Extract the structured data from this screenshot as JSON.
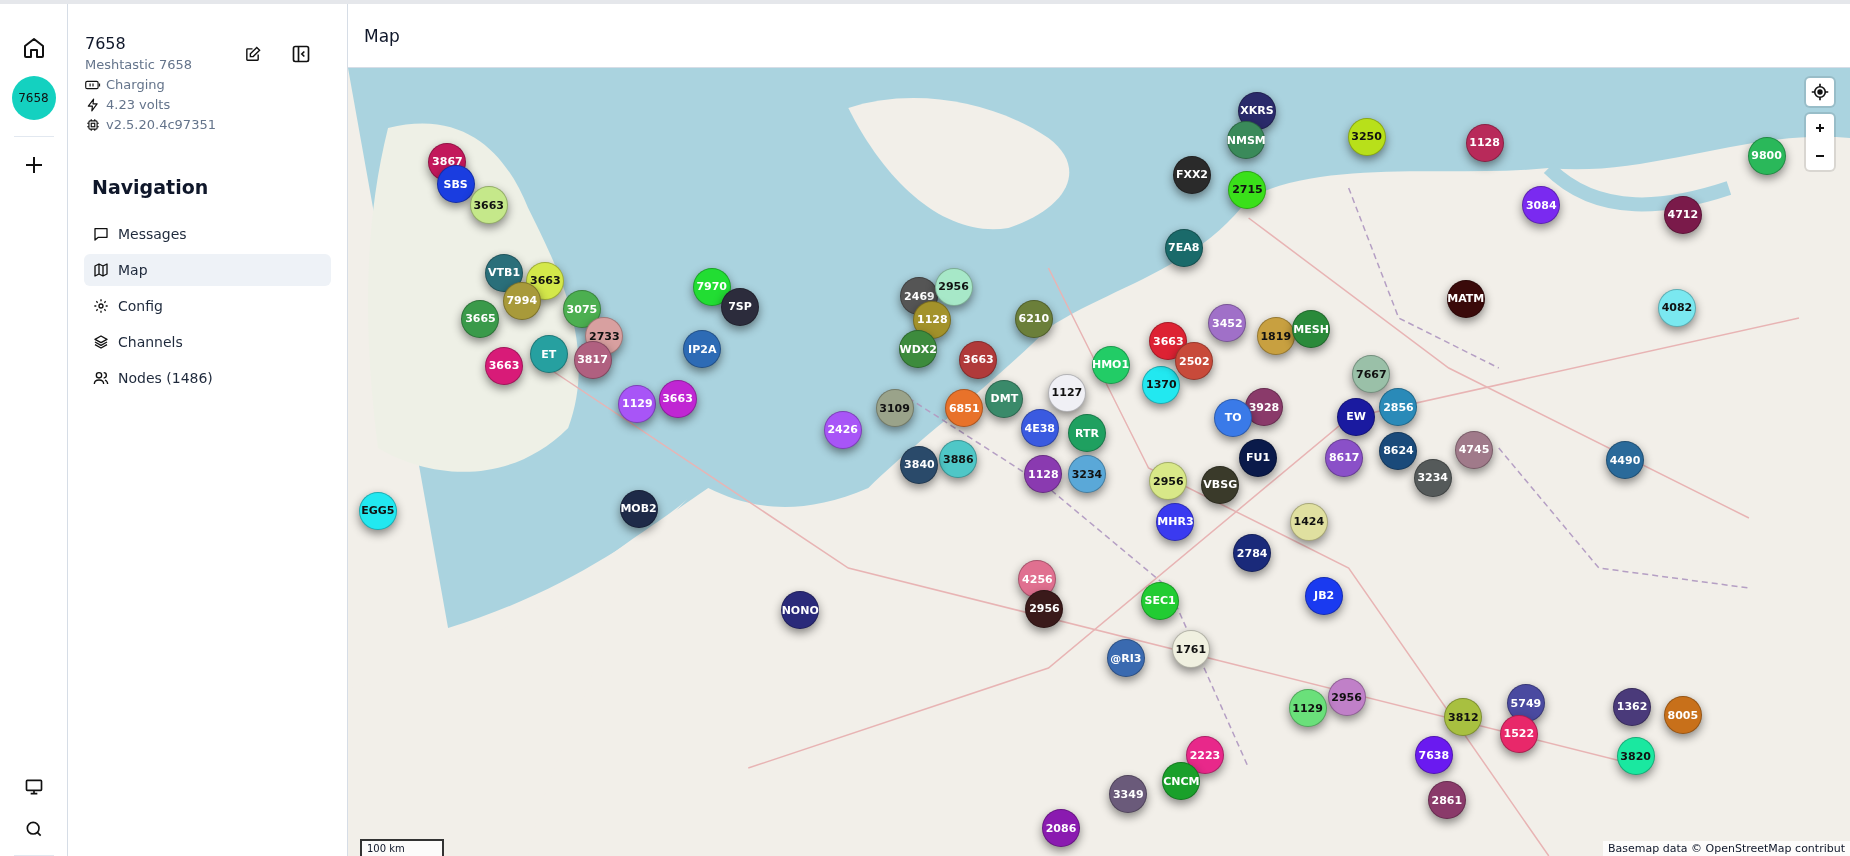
{
  "rail": {
    "avatar": "7658"
  },
  "device": {
    "name": "7658",
    "long_name": "Meshtastic 7658",
    "battery": "Charging",
    "voltage": "4.23 volts",
    "firmware": "v2.5.20.4c97351"
  },
  "navigation": {
    "title": "Navigation",
    "items": [
      {
        "label": "Messages",
        "kind": "messages",
        "selected": false
      },
      {
        "label": "Map",
        "kind": "map",
        "selected": true
      },
      {
        "label": "Config",
        "kind": "config",
        "selected": false
      },
      {
        "label": "Channels",
        "kind": "channels",
        "selected": false
      },
      {
        "label": "Nodes (1486)",
        "kind": "nodes",
        "selected": false
      }
    ]
  },
  "header": {
    "title": "Map"
  },
  "map": {
    "scale": "100 km",
    "attribution": "Basemap data © OpenStreetMap contribut",
    "markers": [
      {
        "label": "3867",
        "color": "#c2185b"
      },
      {
        "label": "SBS",
        "color": "#1a3de0"
      },
      {
        "label": "3663",
        "color": "#c5e88a"
      },
      {
        "label": "VTB1",
        "color": "#2a6f7a"
      },
      {
        "label": "3663",
        "color": "#d4e84a"
      },
      {
        "label": "7994",
        "color": "#a89a3a"
      },
      {
        "label": "3075",
        "color": "#4caf50"
      },
      {
        "label": "2733",
        "color": "#d8a0a0"
      },
      {
        "label": "3665",
        "color": "#3a9a4a"
      },
      {
        "label": "3663",
        "color": "#d81b78"
      },
      {
        "label": "ET",
        "color": "#26a0a0"
      },
      {
        "label": "3817",
        "color": "#b06080"
      },
      {
        "label": "1129",
        "color": "#a855f7"
      },
      {
        "label": "3663",
        "color": "#c026d3"
      },
      {
        "label": "IP2A",
        "color": "#2d6bb5"
      },
      {
        "label": "7970",
        "color": "#22dd33"
      },
      {
        "label": "7SP",
        "color": "#2c2c3c"
      },
      {
        "label": "2469",
        "color": "#555555"
      },
      {
        "label": "2956",
        "color": "#a7e8c8"
      },
      {
        "label": "1128",
        "color": "#a3922a"
      },
      {
        "label": "WDX2",
        "color": "#3d8b3d"
      },
      {
        "label": "6210",
        "color": "#6b7f3a"
      },
      {
        "label": "3663",
        "color": "#b03a3a"
      },
      {
        "label": "DMT",
        "color": "#3a8a6a"
      },
      {
        "label": "3109",
        "color": "#9aa38a"
      },
      {
        "label": "6851",
        "color": "#e8722a"
      },
      {
        "label": "2426",
        "color": "#a855f7"
      },
      {
        "label": "3886",
        "color": "#4fc7c7"
      },
      {
        "label": "3840",
        "color": "#2a4a6a"
      },
      {
        "label": "MOB2",
        "color": "#1e2a48"
      },
      {
        "label": "EGG5",
        "color": "#22e8f0"
      },
      {
        "label": "1127",
        "color": "#f0f0f5"
      },
      {
        "label": "4E38",
        "color": "#3a5ae0"
      },
      {
        "label": "RTR",
        "color": "#1fa060"
      },
      {
        "label": "1128",
        "color": "#8a3ab0"
      },
      {
        "label": "3234",
        "color": "#5aa8d8"
      },
      {
        "label": "HMO1",
        "color": "#22cc66"
      },
      {
        "label": "1370",
        "color": "#22e8f0"
      },
      {
        "label": "3663",
        "color": "#dd2233"
      },
      {
        "label": "2502",
        "color": "#c84a3a"
      },
      {
        "label": "3452",
        "color": "#a070c8"
      },
      {
        "label": "1819",
        "color": "#c8a040"
      },
      {
        "label": "MESH",
        "color": "#2a8a3a"
      },
      {
        "label": "7667",
        "color": "#9ac0a8"
      },
      {
        "label": "3928",
        "color": "#8a3a6a"
      },
      {
        "label": "TO",
        "color": "#3a7ae8"
      },
      {
        "label": "EW",
        "color": "#1a1aa0"
      },
      {
        "label": "2856",
        "color": "#2a8ab8"
      },
      {
        "label": "8624",
        "color": "#1a4a7a"
      },
      {
        "label": "8617",
        "color": "#8a50c8"
      },
      {
        "label": "3234",
        "color": "#555a5a"
      },
      {
        "label": "4745",
        "color": "#a07a8a"
      },
      {
        "label": "FU1",
        "color": "#0a1a4a"
      },
      {
        "label": "VBSG",
        "color": "#3a3a2a"
      },
      {
        "label": "2956",
        "color": "#d8e888"
      },
      {
        "label": "MHR3",
        "color": "#3a3af0"
      },
      {
        "label": "1424",
        "color": "#e0e0a0"
      },
      {
        "label": "2784",
        "color": "#1a2a7a"
      },
      {
        "label": "JB2",
        "color": "#1a3af0"
      },
      {
        "label": "SEC1",
        "color": "#22cc33"
      },
      {
        "label": "4256",
        "color": "#e07090"
      },
      {
        "label": "2956",
        "color": "#3a1a1a"
      },
      {
        "label": "NONO",
        "color": "#2a2a7a"
      },
      {
        "label": "1761",
        "color": "#f0f0e0"
      },
      {
        "label": "@RI3",
        "color": "#3a6ab0"
      },
      {
        "label": "2956",
        "color": "#c080c8"
      },
      {
        "label": "1129",
        "color": "#6ae07a"
      },
      {
        "label": "3812",
        "color": "#a8c040"
      },
      {
        "label": "5749",
        "color": "#4a4aa0"
      },
      {
        "label": "1362",
        "color": "#4a3a7a"
      },
      {
        "label": "8005",
        "color": "#c8701a"
      },
      {
        "label": "1522",
        "color": "#e8286a"
      },
      {
        "label": "2223",
        "color": "#e8288a"
      },
      {
        "label": "7638",
        "color": "#6a1af0"
      },
      {
        "label": "3820",
        "color": "#1ae8a0"
      },
      {
        "label": "CNCM",
        "color": "#1aa02a"
      },
      {
        "label": "3349",
        "color": "#6a5a7a"
      },
      {
        "label": "2861",
        "color": "#8a3a6a"
      },
      {
        "label": "2086",
        "color": "#8a1ab0"
      },
      {
        "label": "XKRS",
        "color": "#2a2a6a"
      },
      {
        "label": "NMSM",
        "color": "#3a8a5a"
      },
      {
        "label": "3250",
        "color": "#b8e01a"
      },
      {
        "label": "1128",
        "color": "#b82a5a"
      },
      {
        "label": "FXX2",
        "color": "#2a2a2a"
      },
      {
        "label": "2715",
        "color": "#3ae01a"
      },
      {
        "label": "7EA8",
        "color": "#1a6a6a"
      },
      {
        "label": "3084",
        "color": "#7a2af0"
      },
      {
        "label": "4712",
        "color": "#7a1a4a"
      },
      {
        "label": "9800",
        "color": "#2ab85a"
      },
      {
        "label": "MATM",
        "color": "#3a0a0a"
      },
      {
        "label": "4082",
        "color": "#7ae8f0"
      },
      {
        "label": "4490",
        "color": "#2a6a9a"
      }
    ]
  }
}
